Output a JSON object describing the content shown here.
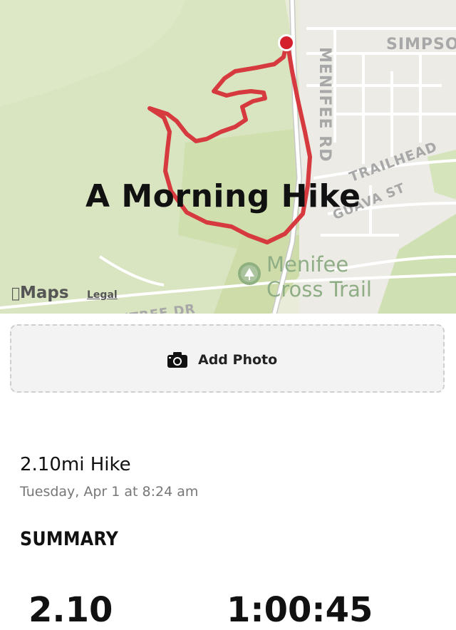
{
  "map": {
    "title": "A Morning Hike",
    "attribution": "Maps",
    "legal": "Legal",
    "streets": {
      "menifee_rd": "MENIFEE RD",
      "simpson": "SIMPSO",
      "trailhead": "TRAILHEAD",
      "guava": "GUAVA ST",
      "ntree": "NTREE DR"
    },
    "poi": {
      "line1": "Menifee",
      "line2": "Cross Trail",
      "icon": "tree-icon"
    },
    "route_color": "#d63a3f",
    "start_marker_color": "#d4202c"
  },
  "add_photo": {
    "label": "Add Photo",
    "icon": "camera-icon"
  },
  "activity": {
    "title": "2.10mi Hike",
    "date": "Tuesday, Apr 1 at 8:24 am"
  },
  "summary": {
    "heading": "SUMMARY",
    "distance": "2.10",
    "duration": "1:00:45"
  }
}
